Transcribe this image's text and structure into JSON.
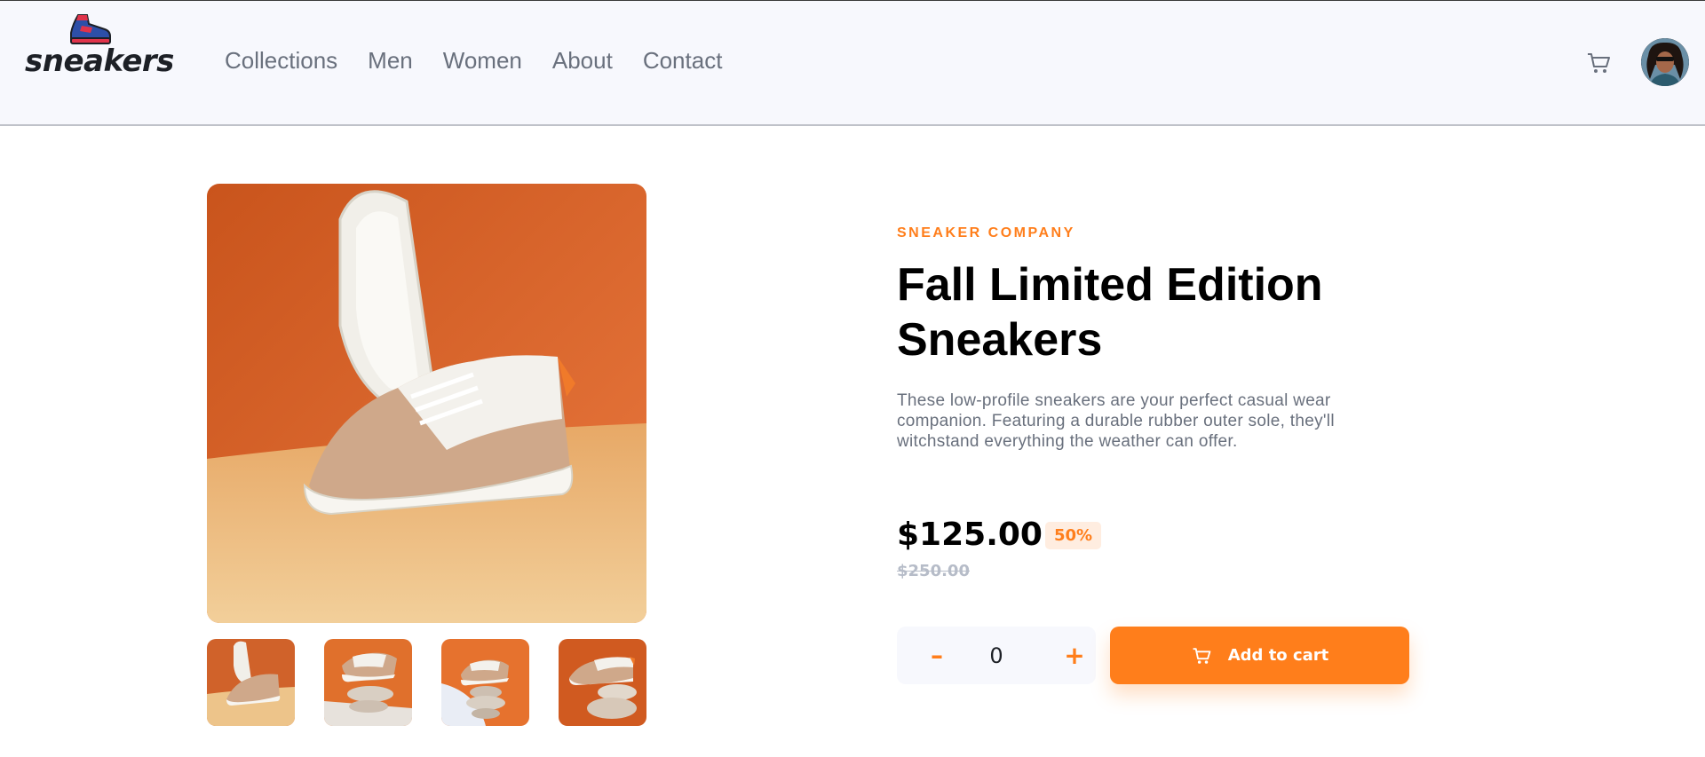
{
  "brand": {
    "logo_text": "sneakers",
    "logo_icon": "sneaker-logo-icon"
  },
  "nav": {
    "items": [
      {
        "label": "Collections"
      },
      {
        "label": "Men"
      },
      {
        "label": "Women"
      },
      {
        "label": "About"
      },
      {
        "label": "Contact"
      }
    ]
  },
  "header": {
    "cart_icon": "cart-icon",
    "avatar_icon": "user-avatar"
  },
  "gallery": {
    "main_image": "product-image-1",
    "thumbnails": [
      "product-thumbnail-1",
      "product-thumbnail-2",
      "product-thumbnail-3",
      "product-thumbnail-4"
    ]
  },
  "product": {
    "company": "SNEAKER COMPANY",
    "title": "Fall Limited Edition Sneakers",
    "description": "These low-profile sneakers are your perfect casual wear companion. Featuring a durable rubber outer sole, they'll witchstand everything the weather can offer.",
    "price": "$125.00",
    "discount": "50%",
    "original_price": "$250.00"
  },
  "cart_controls": {
    "minus_label": "–",
    "quantity": "0",
    "plus_label": "+",
    "add_to_cart_label": "Add to cart"
  },
  "colors": {
    "accent": "#ff7e1b",
    "accent_pale": "#ffede0",
    "header_bg": "#f7f8fd",
    "text_dark": "#000000",
    "text_gray": "#69707d",
    "text_light_gray": "#b6bcc8"
  }
}
